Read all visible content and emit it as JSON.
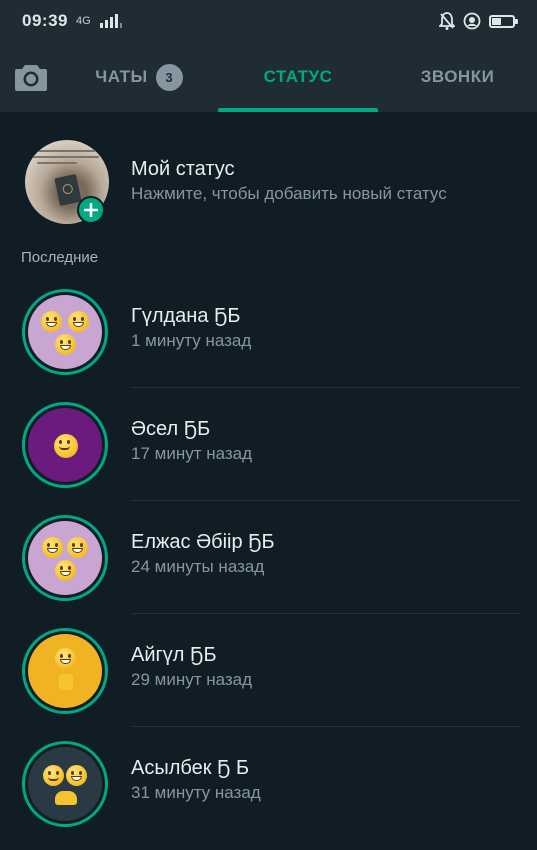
{
  "status_bar": {
    "time": "09:39",
    "network": "4G",
    "icons": [
      "signal-icon",
      "alarm-off-icon",
      "do-not-disturb-icon",
      "battery-icon"
    ]
  },
  "tabs": {
    "camera_icon": "camera-icon",
    "chats": {
      "label": "ЧАТЫ",
      "badge": "3"
    },
    "status": {
      "label": "СТАТУС"
    },
    "calls": {
      "label": "ЗВОНКИ"
    },
    "active": "status"
  },
  "my_status": {
    "title": "Мой статус",
    "subtitle": "Нажмите, чтобы добавить новый статус"
  },
  "section": {
    "recent_label": "Последние"
  },
  "statuses": [
    {
      "name": "Гүлдана ҔБ",
      "time": "1 минуту назад",
      "thumb_color": "#c9a6d2"
    },
    {
      "name": "Әсел ҔБ",
      "time": "17 минут назад",
      "thumb_color": "#6a1b7d"
    },
    {
      "name": "Елжас Әбіір ҔБ",
      "time": "24 минуты назад",
      "thumb_color": "#c9a6d2"
    },
    {
      "name": "Айгүл ҔБ",
      "time": "29 минут назад",
      "thumb_color": "#f0b323"
    },
    {
      "name": "Асылбек Ҕ Б",
      "time": "31 минуту назад",
      "thumb_color": "#2a3a44"
    }
  ],
  "colors": {
    "background": "#101d25",
    "header": "#1f2c34",
    "accent": "#00a884",
    "secondary_text": "#8696a0"
  }
}
